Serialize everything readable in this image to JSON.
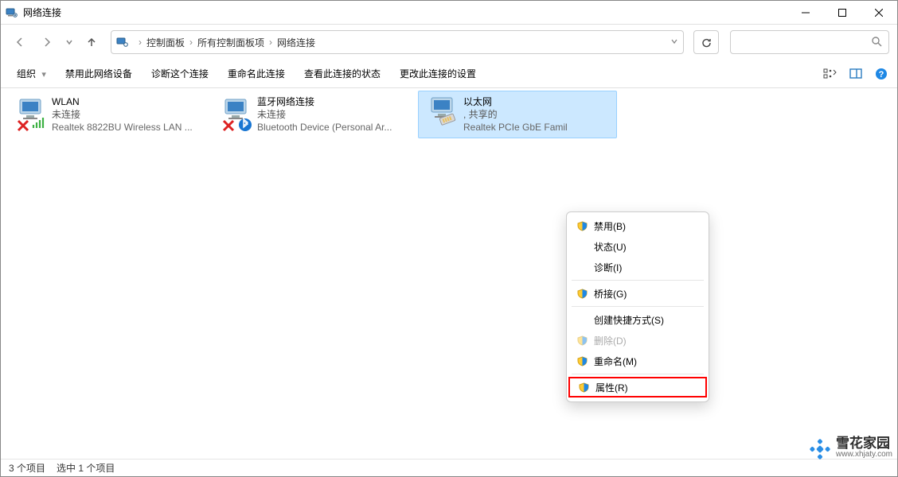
{
  "window": {
    "title": "网络连接"
  },
  "nav": {
    "breadcrumb": [
      "控制面板",
      "所有控制面板项",
      "网络连接"
    ]
  },
  "toolbar": {
    "organize": "组织",
    "items": [
      "禁用此网络设备",
      "诊断这个连接",
      "重命名此连接",
      "查看此连接的状态",
      "更改此连接的设置"
    ]
  },
  "connections": [
    {
      "name": "WLAN",
      "status": "未连接",
      "device": "Realtek 8822BU Wireless LAN ..."
    },
    {
      "name": "蓝牙网络连接",
      "status": "未连接",
      "device": "Bluetooth Device (Personal Ar..."
    },
    {
      "name": "以太网",
      "status": ", 共享的",
      "device": "Realtek PCIe GbE Famil"
    }
  ],
  "context_menu": {
    "disable": "禁用(B)",
    "status": "状态(U)",
    "diagnose": "诊断(I)",
    "bridge": "桥接(G)",
    "shortcut": "创建快捷方式(S)",
    "delete": "删除(D)",
    "rename": "重命名(M)",
    "properties": "属性(R)"
  },
  "statusbar": {
    "count": "3 个项目",
    "selected": "选中 1 个项目"
  },
  "watermark": {
    "main": "雪花家园",
    "sub": "www.xhjaty.com"
  }
}
